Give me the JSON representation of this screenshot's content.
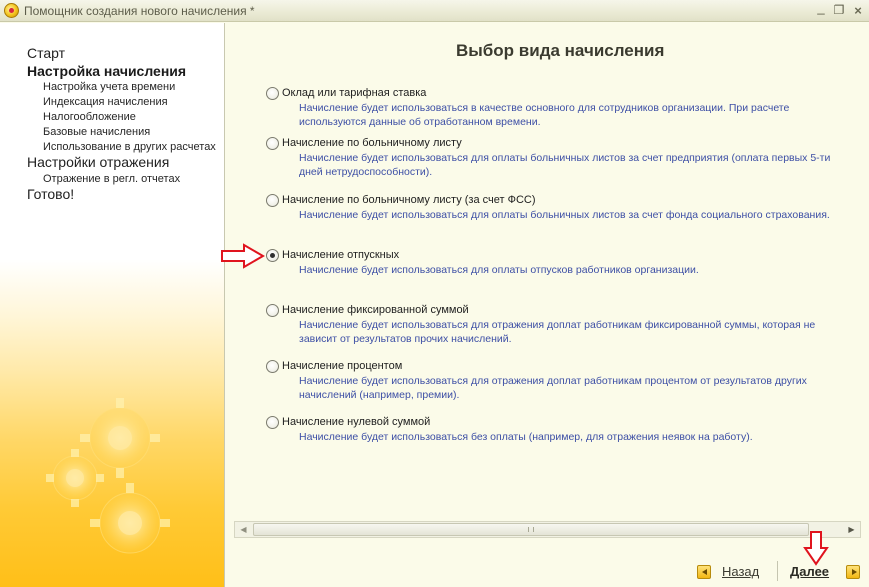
{
  "window": {
    "title": "Помощник создания нового начисления *",
    "minimize": "_",
    "maximize": "❐",
    "close": "×"
  },
  "sidebar": {
    "items": [
      {
        "label": "Старт",
        "level": 0,
        "active": false
      },
      {
        "label": "Настройка начисления",
        "level": 0,
        "active": true
      },
      {
        "label": "Настройка учета времени",
        "level": 1
      },
      {
        "label": "Индексация начисления",
        "level": 1
      },
      {
        "label": "Налогообложение",
        "level": 1
      },
      {
        "label": "Базовые начисления",
        "level": 1
      },
      {
        "label": "Использование в других расчетах",
        "level": 1
      },
      {
        "label": "Настройки отражения",
        "level": 0,
        "active": false
      },
      {
        "label": "Отражение в регл. отчетах",
        "level": 1
      },
      {
        "label": "Готово!",
        "level": 0,
        "active": false
      }
    ]
  },
  "main": {
    "title": "Выбор вида начисления",
    "options": [
      {
        "label": "Оклад или тарифная ставка",
        "description": "Начисление будет использоваться в качестве основного для сотрудников организации. При расчете используются данные об отработанном времени.",
        "selected": false
      },
      {
        "label": "Начисление по больничному листу",
        "description": "Начисление будет использоваться для оплаты больничных листов за счет предприятия (оплата первых 5-ти дней нетрудоспособности).",
        "selected": false
      },
      {
        "label": "Начисление по больничному листу (за счет ФСС)",
        "description": "Начисление будет использоваться для оплаты больничных листов за счет фонда социального страхования.",
        "selected": false
      },
      {
        "label": "Начисление отпускных",
        "description": "Начисление будет использоваться для оплаты отпусков работников организации.",
        "selected": true
      },
      {
        "label": "Начисление фиксированной суммой",
        "description": "Начисление будет использоваться для отражения доплат работникам фиксированной суммы, которая не зависит от результатов прочих начислений.",
        "selected": false
      },
      {
        "label": "Начисление процентом",
        "description": "Начисление будет использоваться для отражения доплат работникам процентом от результатов других начислений (например, премии).",
        "selected": false
      },
      {
        "label": "Начисление нулевой суммой",
        "description": "Начисление будет использоваться без оплаты (например, для отражения неявок на работу).",
        "selected": false
      }
    ]
  },
  "footer": {
    "back_label": "Назад",
    "next_label": "Далее"
  },
  "colors": {
    "description_text": "#3d4fa5",
    "annotation_arrow": "#e0141e",
    "sidebar_gradient_bottom": "#ffbf18"
  },
  "icons": {
    "app": "1c-app-icon",
    "back": "arrow-left-icon",
    "next": "arrow-right-icon",
    "annotation_right": "red-arrow-right-icon",
    "annotation_down": "red-arrow-down-icon"
  }
}
